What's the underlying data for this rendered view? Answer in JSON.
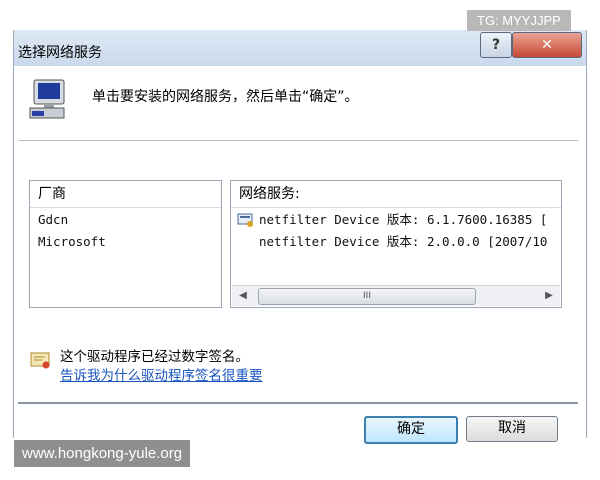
{
  "window": {
    "title": "选择网络服务",
    "help_label": "?",
    "close_label": "✕"
  },
  "instruction": "单击要安装的网络服务，然后单击“确定”。",
  "manufacturers": {
    "header": "厂商",
    "items": [
      "Gdcn",
      "Microsoft"
    ]
  },
  "services": {
    "header": "网络服务:",
    "items": [
      "netfilter Device 版本: 6.1.7600.16385 [",
      "netfilter Device 版本: 2.0.0.0 [2007/10"
    ],
    "scroll_left": "◀",
    "scroll_right": "▶",
    "thumb_grip": "III"
  },
  "signed_text": "这个驱动程序已经过数字签名。",
  "why_link": "告诉我为什么驱动程序签名很重要",
  "buttons": {
    "ok": "确定",
    "cancel": "取消"
  },
  "watermarks": {
    "top": "TG: MYYJJPP",
    "bottom": "www.hongkong-yule.org"
  }
}
